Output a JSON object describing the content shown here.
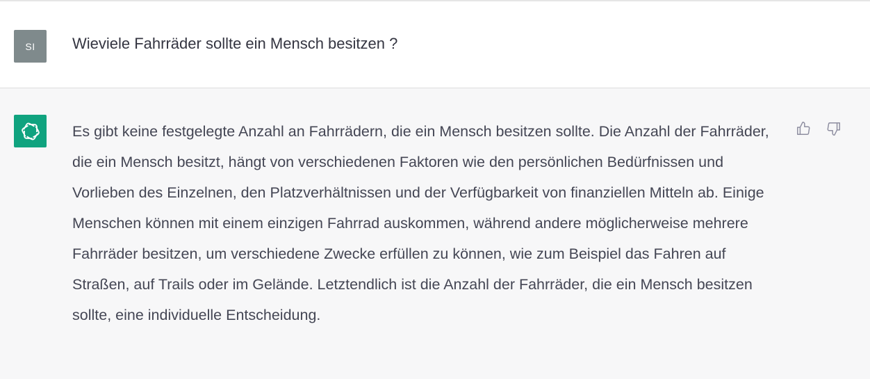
{
  "user_message": {
    "avatar_initials": "SI",
    "text": "Wieviele Fahrräder sollte ein Mensch besitzen ?"
  },
  "assistant_message": {
    "avatar_icon": "openai-logo-icon",
    "text": "Es gibt keine festgelegte Anzahl an Fahrrädern, die ein Mensch besitzen sollte. Die Anzahl der Fahrräder, die ein Mensch besitzt, hängt von verschiedenen Faktoren wie den persönlichen Bedürfnissen und Vorlieben des Einzelnen, den Platzverhältnissen und der Verfügbarkeit von finanziellen Mitteln ab. Einige Menschen können mit einem einzigen Fahrrad auskommen, während andere möglicherweise mehrere Fahrräder besitzen, um verschiedene Zwecke erfüllen zu können, wie zum Beispiel das Fahren auf Straßen, auf Trails oder im Gelände. Letztendlich ist die Anzahl der Fahrräder, die ein Mensch besitzen sollte, eine individuelle Entscheidung."
  },
  "feedback": {
    "thumbs_up_icon": "thumbs-up-icon",
    "thumbs_down_icon": "thumbs-down-icon"
  },
  "colors": {
    "user_avatar": "#7f8a8c",
    "assistant_avatar": "#10a37f",
    "user_bg": "#ffffff",
    "assistant_bg": "#f7f7f8",
    "text": "#444654"
  }
}
